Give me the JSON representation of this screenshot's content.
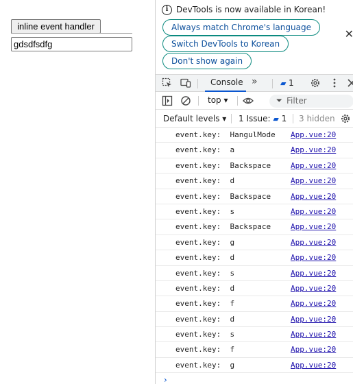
{
  "page": {
    "button_label": "inline event handler",
    "input_value": "gdsdfsdfg"
  },
  "devtools": {
    "infobar": {
      "message": "DevTools is now available in Korean!",
      "buttons": [
        "Always match Chrome's language",
        "Switch DevTools to Korean",
        "Don't show again"
      ],
      "close_glyph": "✕"
    },
    "tabs": {
      "console_label": "Console",
      "more_glyph": "»",
      "issues_badge_count": "1"
    },
    "toolbar": {
      "context_label": "top",
      "filter_placeholder": "Filter"
    },
    "levels_bar": {
      "levels_label": "Default levels",
      "issues_label": "1 Issue:",
      "issues_count": "1",
      "hidden_label": "3 hidden"
    },
    "logs": [
      {
        "message": "event.key:  HangulMode",
        "source": "App.vue:20"
      },
      {
        "message": "event.key:  a",
        "source": "App.vue:20"
      },
      {
        "message": "event.key:  Backspace",
        "source": "App.vue:20"
      },
      {
        "message": "event.key:  d",
        "source": "App.vue:20"
      },
      {
        "message": "event.key:  Backspace",
        "source": "App.vue:20"
      },
      {
        "message": "event.key:  s",
        "source": "App.vue:20"
      },
      {
        "message": "event.key:  Backspace",
        "source": "App.vue:20"
      },
      {
        "message": "event.key:  g",
        "source": "App.vue:20"
      },
      {
        "message": "event.key:  d",
        "source": "App.vue:20"
      },
      {
        "message": "event.key:  s",
        "source": "App.vue:20"
      },
      {
        "message": "event.key:  d",
        "source": "App.vue:20"
      },
      {
        "message": "event.key:  f",
        "source": "App.vue:20"
      },
      {
        "message": "event.key:  d",
        "source": "App.vue:20"
      },
      {
        "message": "event.key:  s",
        "source": "App.vue:20"
      },
      {
        "message": "event.key:  f",
        "source": "App.vue:20"
      },
      {
        "message": "event.key:  g",
        "source": "App.vue:20"
      }
    ],
    "prompt_glyph": "›",
    "colors": {
      "accent": "#0b57d0",
      "link": "#1a0dab",
      "pill_border": "#0b8a7f"
    }
  }
}
